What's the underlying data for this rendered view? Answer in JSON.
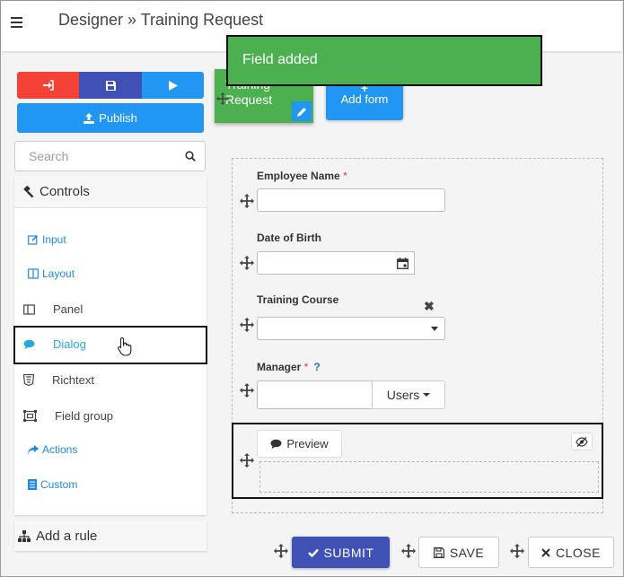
{
  "header": {
    "title": "Designer » Training Request",
    "menu_icon": "hamburger-icon"
  },
  "toast": {
    "message": "Field added"
  },
  "toolbar": {
    "exit_icon": "sign-in-icon",
    "save_icon": "floppy-icon",
    "run_icon": "play-icon",
    "publish_label": "Publish"
  },
  "search": {
    "placeholder": "Search"
  },
  "controls": {
    "title": "Controls",
    "items": [
      {
        "label": "Input",
        "icon": "edit-icon"
      },
      {
        "label": "Layout",
        "icon": "columns-icon"
      },
      {
        "label": "Panel",
        "icon": "panel-icon"
      },
      {
        "label": "Dialog",
        "icon": "comment-icon"
      },
      {
        "label": "Richtext",
        "icon": "html5-icon"
      },
      {
        "label": "Field group",
        "icon": "field-group-icon"
      },
      {
        "label": "Actions",
        "icon": "share-icon"
      },
      {
        "label": "Custom",
        "icon": "custom-icon"
      }
    ]
  },
  "rule": {
    "label": "Add a rule"
  },
  "forms": {
    "current": "Training Request",
    "add_label": "Add form"
  },
  "fields": {
    "employee_name": {
      "label": "Employee Name",
      "required": "*",
      "value": ""
    },
    "dob": {
      "label": "Date of Birth",
      "value": ""
    },
    "course": {
      "label": "Training Course",
      "clear": "✖",
      "value": ""
    },
    "manager": {
      "label": "Manager",
      "required": "*",
      "help": "?",
      "value": "",
      "button": "Users"
    },
    "preview": {
      "label": "Preview"
    }
  },
  "actions": {
    "submit": "SUBMIT",
    "save": "SAVE",
    "close": "CLOSE"
  },
  "colors": {
    "danger": "#f44336",
    "primary": "#3f51b5",
    "info": "#2196f3",
    "success": "#4caf50"
  }
}
